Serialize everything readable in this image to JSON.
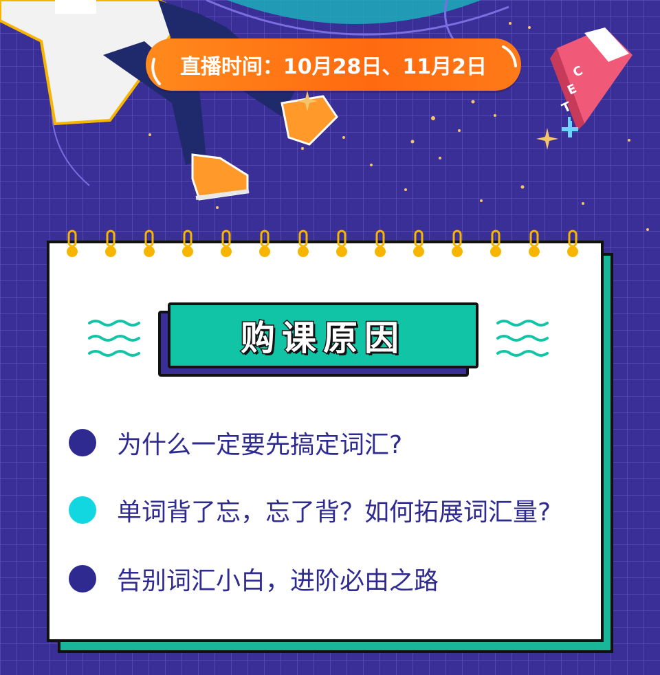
{
  "header": {
    "live_time_text": "直播时间：10月28日、11月2日"
  },
  "book": {
    "letters": [
      "C",
      "E",
      "T"
    ]
  },
  "card": {
    "title": "购课原因",
    "items": [
      {
        "text": "为什么一定要先搞定词汇?",
        "dot_color": "#2e2a8f"
      },
      {
        "text": "单词背了忘，忘了背？如何拓展词汇量?",
        "dot_color": "#12d6e0"
      },
      {
        "text": "告别词汇小白，进阶必由之路",
        "dot_color": "#2e2a8f"
      }
    ]
  },
  "colors": {
    "background": "#3a2f96",
    "accent_orange": "#ff7a18",
    "accent_teal": "#12c4a6",
    "text_navy": "#2e2a8f",
    "ring_yellow": "#f7b500"
  }
}
